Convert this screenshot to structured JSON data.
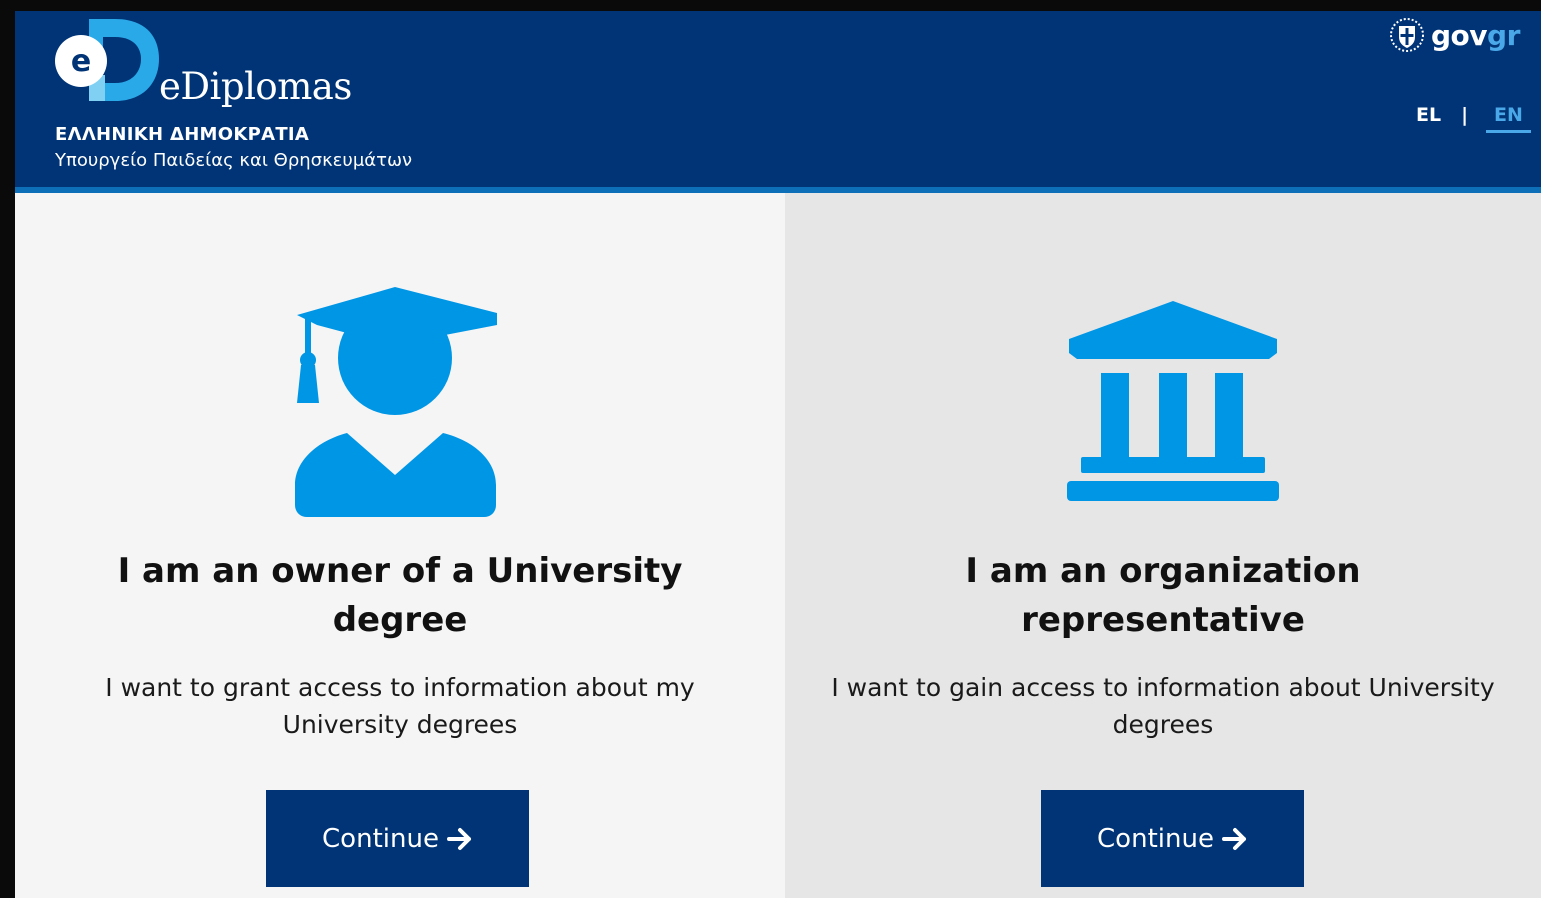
{
  "header": {
    "logo_icon": "ediplomas-logo-icon",
    "brand_name": "eDiplomas",
    "republic": "ΕΛΛΗΝΙΚΗ ΔΗΜΟΚΡΑΤΙΑ",
    "ministry": "Υπουργείο Παιδείας και Θρησκευμάτων",
    "govgr": {
      "emblem_icon": "greek-coat-of-arms-icon",
      "gov": "gov",
      "gr": "gr"
    },
    "languages": {
      "el": "EL",
      "separator": "|",
      "en": "EN",
      "active": "EN"
    },
    "colors": {
      "background": "#003476",
      "stripe": "#0d6fb8",
      "accent": "#4aa8e8"
    }
  },
  "panels": [
    {
      "icon": "graduate-icon",
      "title": "I am an owner of a University degree",
      "description": "I want to grant access to information about my University degrees",
      "button_label": "Continue",
      "button_icon": "arrow-right-icon"
    },
    {
      "icon": "institution-icon",
      "title": "I am an organization representative",
      "description": "I want to gain access to information about University degrees",
      "button_label": "Continue",
      "button_icon": "arrow-right-icon"
    }
  ],
  "colors": {
    "icon": "#0096e6",
    "button": "#003476",
    "left_bg": "#f5f5f5",
    "right_bg": "#e6e6e6"
  }
}
